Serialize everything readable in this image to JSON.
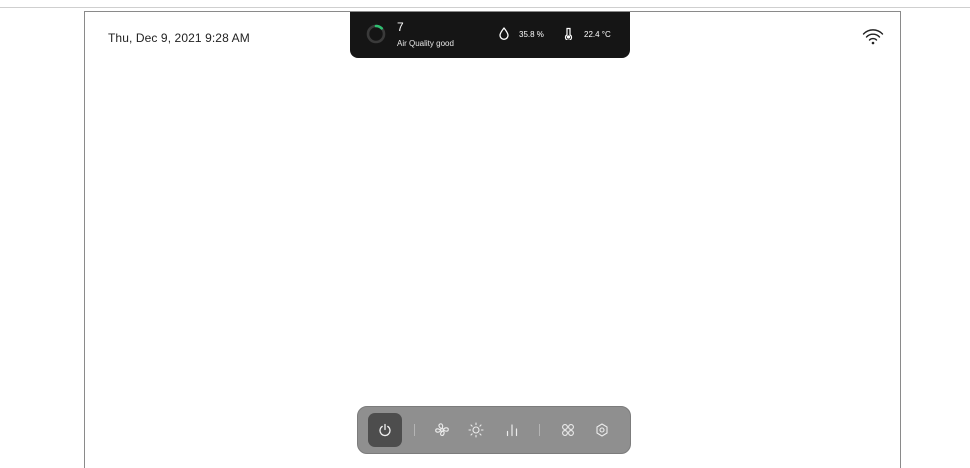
{
  "header": {
    "datetime": "Thu, Dec 9, 2021 9:28 AM"
  },
  "status_card": {
    "air_quality_value": "7",
    "air_quality_label": "Air Quality good",
    "air_quality_level": 0.15,
    "humidity": "35.8 %",
    "temperature": "22.4 °C",
    "colors": {
      "background": "#151515",
      "ring_track": "#3a3a3a",
      "ring_indicator": "#2fbf71"
    }
  },
  "connectivity": {
    "icon": "wifi-icon"
  },
  "control_bar": {
    "items": [
      {
        "icon": "power-icon",
        "active": true
      },
      {
        "icon": "fan-icon"
      },
      {
        "icon": "brightness-icon"
      },
      {
        "icon": "levels-icon"
      },
      {
        "icon": "apps-icon"
      },
      {
        "icon": "settings-icon"
      }
    ],
    "colors": {
      "bar": "#8f8f8f",
      "active_button": "#4d4d4d",
      "icon": "#ececec"
    }
  }
}
